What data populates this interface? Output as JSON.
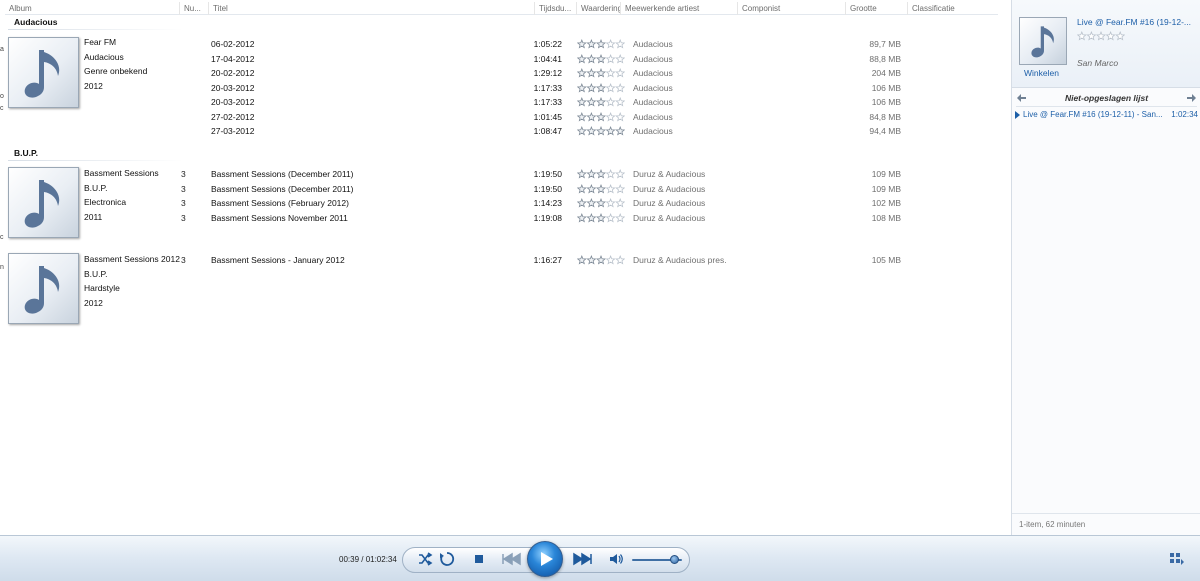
{
  "columns": [
    "Album",
    "Nu...",
    "Titel",
    "Tijdsdu...",
    "Waardering",
    "Meewerkende artiest",
    "Componist",
    "Grootte",
    "Classificatie"
  ],
  "edge_glyphs": [
    "a",
    "o",
    "c",
    "c",
    "n"
  ],
  "groups": [
    {
      "label": "Audacious",
      "albums": [
        {
          "meta": [
            "Fear FM",
            "Audacious",
            "Genre onbekend",
            "2012"
          ],
          "tracks": [
            {
              "num": "",
              "title": "06-02-2012",
              "duration": "1:05:22",
              "rating": 3,
              "artist": "Audacious",
              "size": "89,7 MB"
            },
            {
              "num": "",
              "title": "17-04-2012",
              "duration": "1:04:41",
              "rating": 3,
              "artist": "Audacious",
              "size": "88,8 MB"
            },
            {
              "num": "",
              "title": "20-02-2012",
              "duration": "1:29:12",
              "rating": 3,
              "artist": "Audacious",
              "size": "204 MB"
            },
            {
              "num": "",
              "title": "20-03-2012",
              "duration": "1:17:33",
              "rating": 3,
              "artist": "Audacious",
              "size": "106 MB"
            },
            {
              "num": "",
              "title": "20-03-2012",
              "duration": "1:17:33",
              "rating": 3,
              "artist": "Audacious",
              "size": "106 MB"
            },
            {
              "num": "",
              "title": "27-02-2012",
              "duration": "1:01:45",
              "rating": 3,
              "artist": "Audacious",
              "size": "84,8 MB"
            },
            {
              "num": "",
              "title": "27-03-2012",
              "duration": "1:08:47",
              "rating": 5,
              "artist": "Audacious",
              "size": "94,4 MB"
            }
          ]
        }
      ]
    },
    {
      "label": "B.U.P.",
      "albums": [
        {
          "meta": [
            "Bassment Sessions",
            "B.U.P.",
            "Electronica",
            "2011"
          ],
          "tracks": [
            {
              "num": "3",
              "title": "Bassment Sessions (December 2011)",
              "duration": "1:19:50",
              "rating": 3,
              "artist": "Duruz & Audacious",
              "size": "109 MB"
            },
            {
              "num": "3",
              "title": "Bassment Sessions (December 2011)",
              "duration": "1:19:50",
              "rating": 3,
              "artist": "Duruz & Audacious",
              "size": "109 MB"
            },
            {
              "num": "3",
              "title": "Bassment Sessions (February 2012)",
              "duration": "1:14:23",
              "rating": 3,
              "artist": "Duruz & Audacious",
              "size": "102 MB"
            },
            {
              "num": "3",
              "title": "Bassment Sessions November 2011",
              "duration": "1:19:08",
              "rating": 3,
              "artist": "Duruz & Audacious",
              "size": "108 MB"
            }
          ]
        },
        {
          "meta": [
            "Bassment Sessions 2012",
            "B.U.P.",
            "Hardstyle",
            "2012"
          ],
          "tracks": [
            {
              "num": "3",
              "title": "Bassment Sessions - January 2012",
              "duration": "1:16:27",
              "rating": 3,
              "artist": "Duruz & Audacious pres.",
              "size": "105 MB"
            }
          ]
        }
      ]
    }
  ],
  "now_playing": {
    "title": "Live @ Fear.FM #16 (19-12-...",
    "rating": 0,
    "artist": "San Marco",
    "store_label": "Winkelen"
  },
  "playlist": {
    "name": "Niet-opgeslagen lijst",
    "items": [
      {
        "title": "Live @ Fear.FM #16 (19-12-11) - San...",
        "duration": "1:02:34"
      }
    ],
    "footer": "1-item, 62 minuten"
  },
  "transport": {
    "time": "00:39 / 01:02:34",
    "volume": 0.85
  },
  "colors": {
    "link": "#1d5fa8",
    "star": "#7d8996",
    "play": "#2a86d8"
  }
}
